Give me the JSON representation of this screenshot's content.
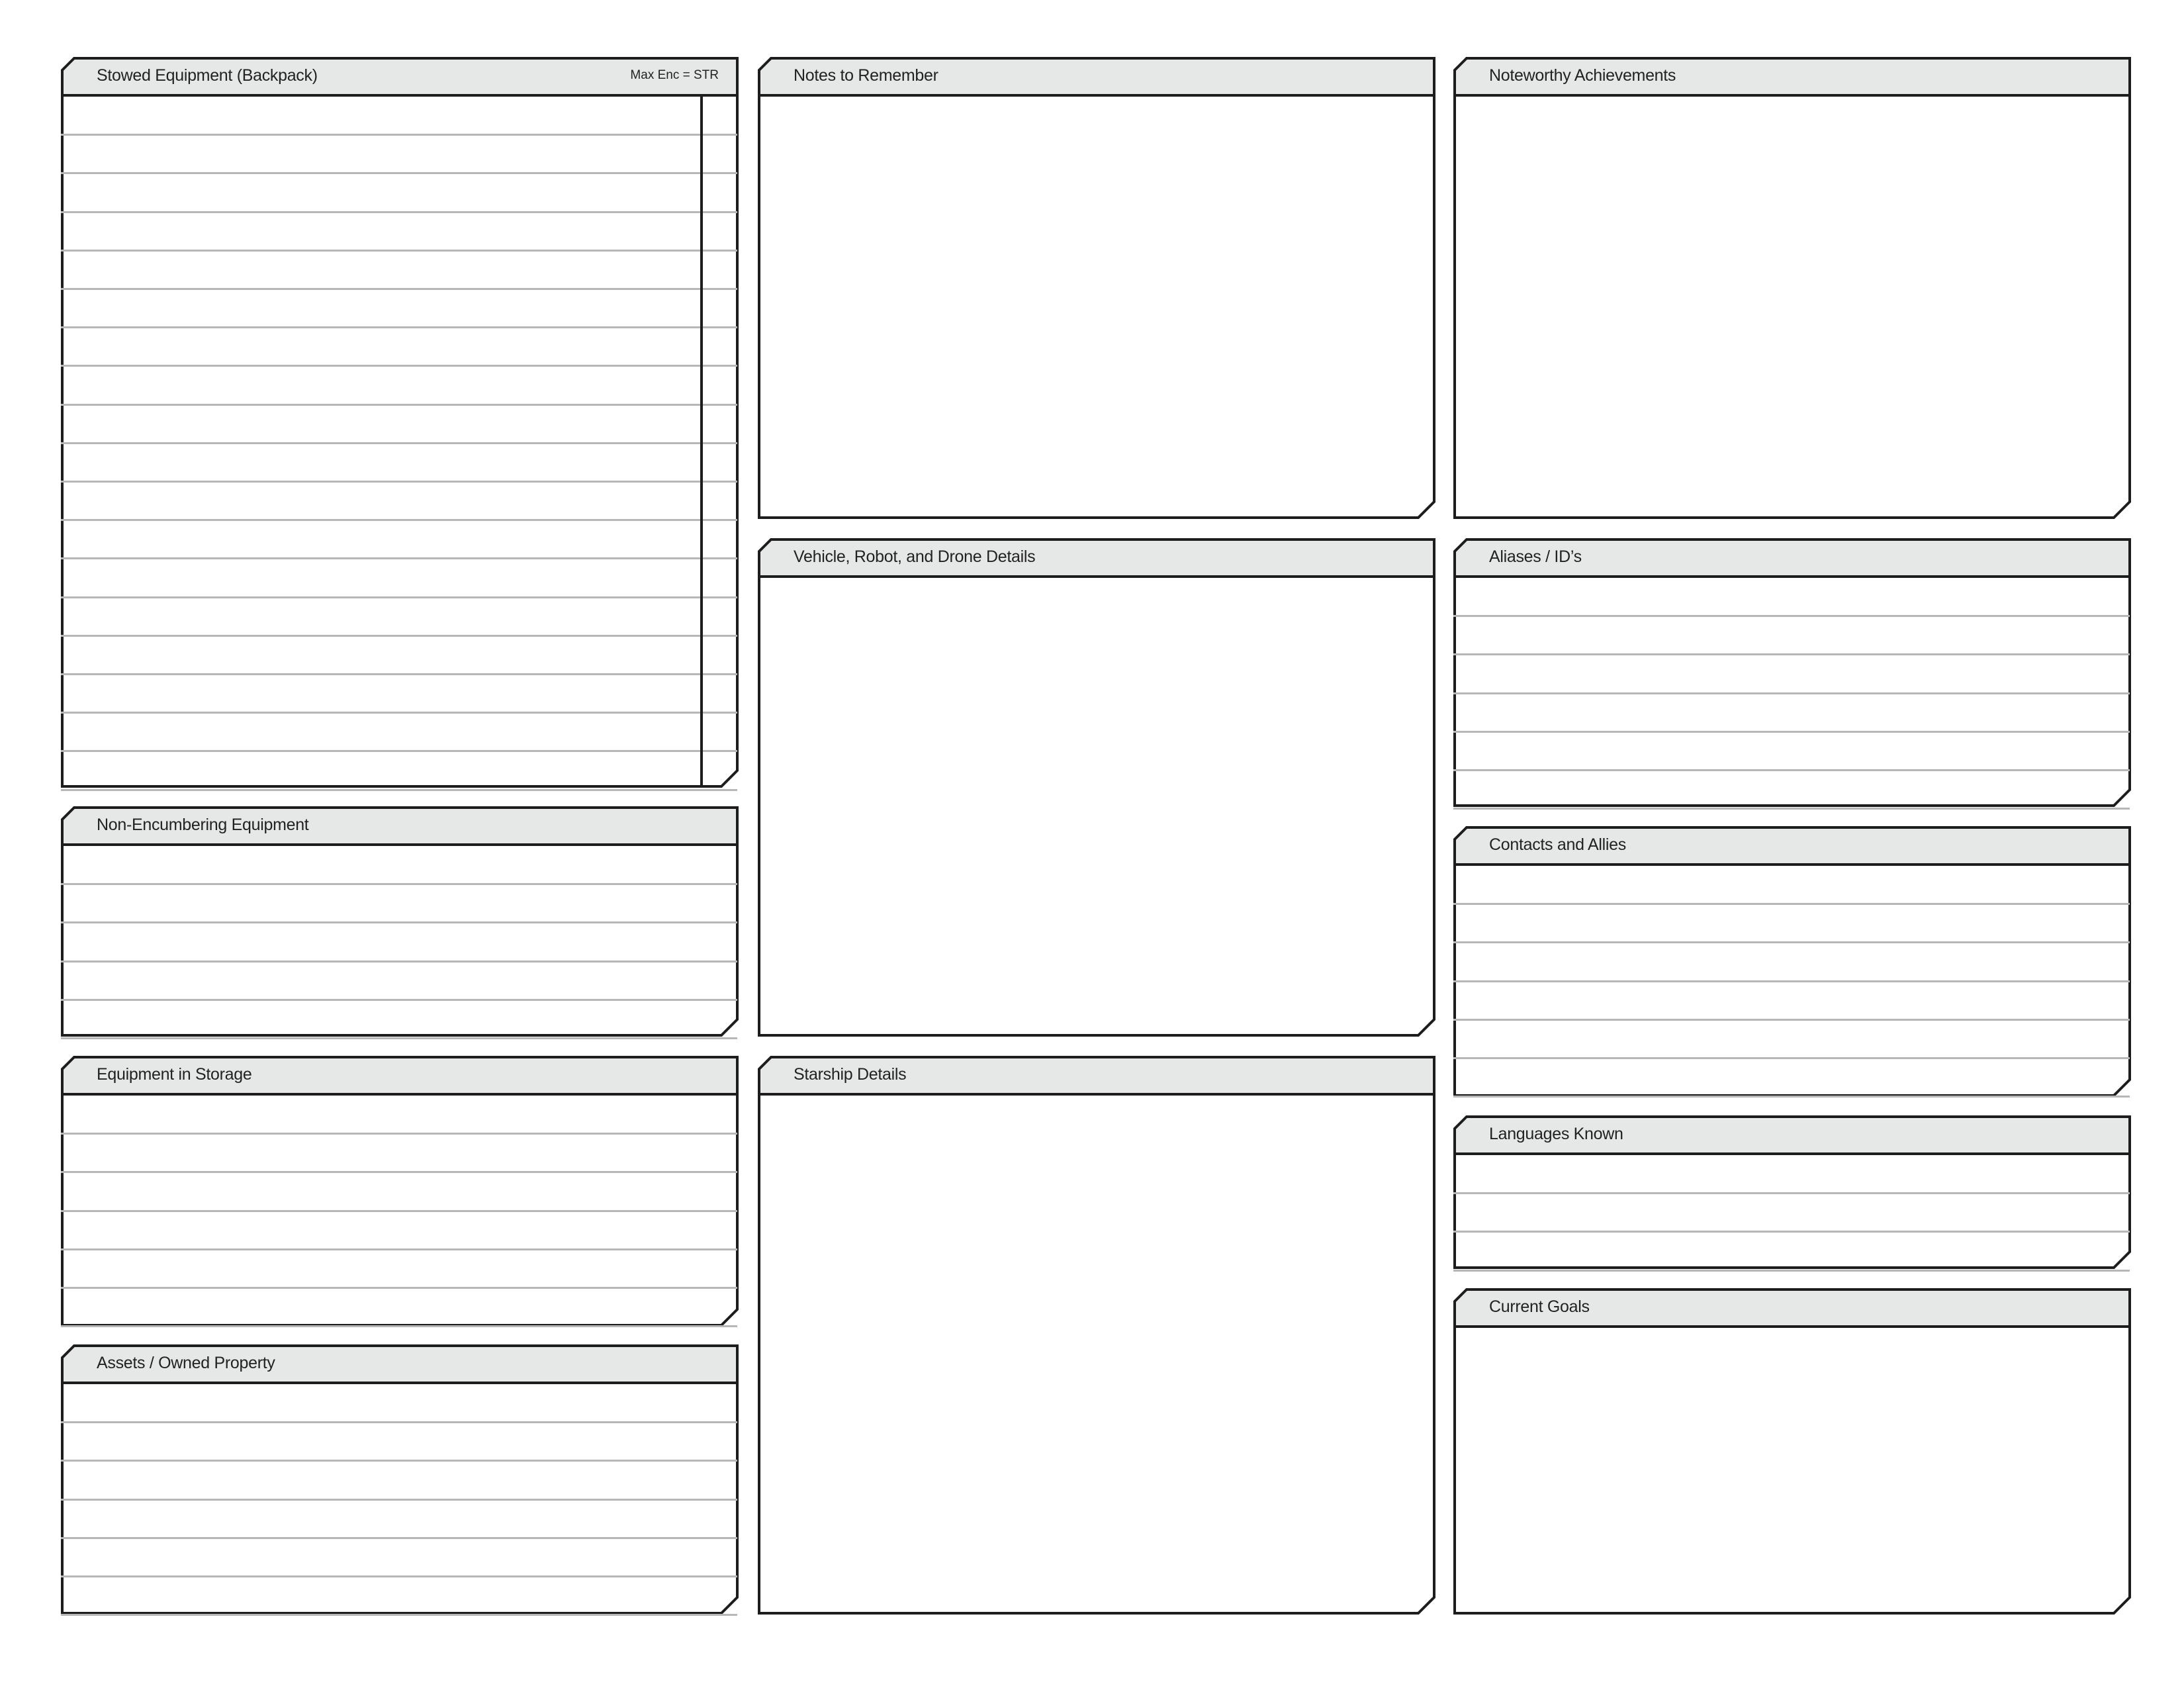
{
  "colors": {
    "border": "#1d1d1d",
    "header_fill": "#e6e7e7",
    "rule": "#b7b7b7"
  },
  "panels": [
    {
      "id": "stowed-equipment",
      "title": "Stowed Equipment (Backpack)",
      "note": "Max Enc = STR",
      "lines": 18,
      "column": true
    },
    {
      "id": "non-encumbering-equipment",
      "title": "Non-Encumbering Equipment",
      "lines": 5
    },
    {
      "id": "equipment-in-storage",
      "title": "Equipment in Storage",
      "lines": 6
    },
    {
      "id": "assets-owned-property",
      "title": "Assets / Owned Property",
      "lines": 6
    },
    {
      "id": "notes-to-remember",
      "title": "Notes to Remember",
      "lines": 0
    },
    {
      "id": "vehicle-robot-drone-details",
      "title": "Vehicle, Robot, and Drone Details",
      "lines": 0
    },
    {
      "id": "starship-details",
      "title": "Starship Details",
      "lines": 0
    },
    {
      "id": "noteworthy-achievements",
      "title": "Noteworthy Achievements",
      "lines": 0
    },
    {
      "id": "aliases-ids",
      "title": "Aliases / ID’s",
      "lines": 6
    },
    {
      "id": "contacts-and-allies",
      "title": "Contacts and Allies",
      "lines": 6
    },
    {
      "id": "languages-known",
      "title": "Languages Known",
      "lines": 3
    },
    {
      "id": "current-goals",
      "title": "Current Goals",
      "lines": 0
    }
  ]
}
